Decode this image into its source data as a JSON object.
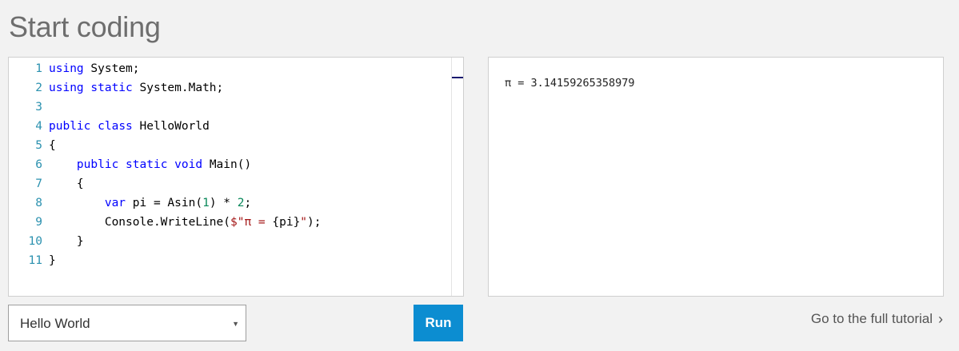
{
  "page": {
    "title": "Start coding"
  },
  "editor": {
    "lines": [
      {
        "n": "1",
        "tokens": [
          {
            "t": "using",
            "c": "kw"
          },
          {
            "t": " System;",
            "c": ""
          }
        ]
      },
      {
        "n": "2",
        "tokens": [
          {
            "t": "using",
            "c": "kw"
          },
          {
            "t": " ",
            "c": ""
          },
          {
            "t": "static",
            "c": "kw"
          },
          {
            "t": " System.Math;",
            "c": ""
          }
        ]
      },
      {
        "n": "3",
        "tokens": []
      },
      {
        "n": "4",
        "tokens": [
          {
            "t": "public",
            "c": "kw"
          },
          {
            "t": " ",
            "c": ""
          },
          {
            "t": "class",
            "c": "kw"
          },
          {
            "t": " HelloWorld",
            "c": ""
          }
        ]
      },
      {
        "n": "5",
        "tokens": [
          {
            "t": "{",
            "c": ""
          }
        ]
      },
      {
        "n": "6",
        "tokens": [
          {
            "t": "    ",
            "c": ""
          },
          {
            "t": "public",
            "c": "kw"
          },
          {
            "t": " ",
            "c": ""
          },
          {
            "t": "static",
            "c": "kw"
          },
          {
            "t": " ",
            "c": ""
          },
          {
            "t": "void",
            "c": "kw"
          },
          {
            "t": " Main()",
            "c": ""
          }
        ]
      },
      {
        "n": "7",
        "tokens": [
          {
            "t": "    {",
            "c": ""
          }
        ]
      },
      {
        "n": "8",
        "tokens": [
          {
            "t": "        ",
            "c": ""
          },
          {
            "t": "var",
            "c": "kw"
          },
          {
            "t": " pi = Asin(",
            "c": ""
          },
          {
            "t": "1",
            "c": "num"
          },
          {
            "t": ") * ",
            "c": ""
          },
          {
            "t": "2",
            "c": "num"
          },
          {
            "t": ";",
            "c": ""
          }
        ]
      },
      {
        "n": "9",
        "tokens": [
          {
            "t": "        Console.WriteLine(",
            "c": ""
          },
          {
            "t": "$\"π = ",
            "c": "str"
          },
          {
            "t": "{pi}",
            "c": ""
          },
          {
            "t": "\"",
            "c": "str"
          },
          {
            "t": ");",
            "c": ""
          }
        ]
      },
      {
        "n": "10",
        "tokens": [
          {
            "t": "    }",
            "c": ""
          }
        ]
      },
      {
        "n": "11",
        "tokens": [
          {
            "t": "}",
            "c": ""
          }
        ]
      }
    ]
  },
  "output": {
    "text": "π = 3.14159265358979"
  },
  "example_select": {
    "value": "Hello World"
  },
  "run_button": {
    "label": "Run"
  },
  "tutorial_link": {
    "label": "Go to the full tutorial"
  }
}
